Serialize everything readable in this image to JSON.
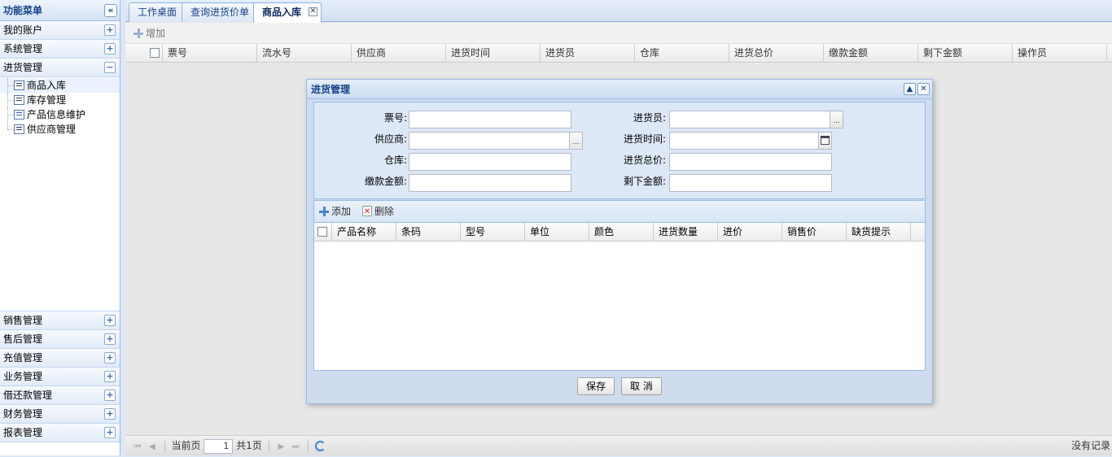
{
  "sidebar": {
    "title": "功能菜单",
    "collapse_icon": "«",
    "groups_top": [
      {
        "label": "我的账户",
        "toggle": "+"
      },
      {
        "label": "系统管理",
        "toggle": "+"
      },
      {
        "label": "进货管理",
        "toggle": "−"
      }
    ],
    "tree_items": [
      {
        "label": "商品入库",
        "selected": true
      },
      {
        "label": "库存管理",
        "selected": false
      },
      {
        "label": "产品信息维护",
        "selected": false
      },
      {
        "label": "供应商管理",
        "selected": false
      }
    ],
    "groups_bottom": [
      {
        "label": "销售管理",
        "toggle": "+"
      },
      {
        "label": "售后管理",
        "toggle": "+"
      },
      {
        "label": "充值管理",
        "toggle": "+"
      },
      {
        "label": "业务管理",
        "toggle": "+"
      },
      {
        "label": "借还款管理",
        "toggle": "+"
      },
      {
        "label": "财务管理",
        "toggle": "+"
      },
      {
        "label": "报表管理",
        "toggle": "+"
      }
    ]
  },
  "tabs": [
    {
      "label": "工作桌面"
    },
    {
      "label": "查询进货价单"
    },
    {
      "label": "商品入库",
      "active": true,
      "close": "✕"
    }
  ],
  "toolbar": {
    "add_label": "增加"
  },
  "main_grid": {
    "columns": [
      "票号",
      "流水号",
      "供应商",
      "进货时间",
      "进货员",
      "仓库",
      "进货总价",
      "缴款金额",
      "剩下金额",
      "操作员"
    ]
  },
  "pager": {
    "first": "⏮",
    "prev": "◀",
    "next": "▶",
    "last": "⏭",
    "current_label": "当前页",
    "page_value": "1",
    "total_label": "共1页",
    "info": "没有记录"
  },
  "dialog": {
    "title": "进货管理",
    "collapse_icon": "▲",
    "close_icon": "✕",
    "form": {
      "ticket_no_label": "票号:",
      "buyer_label": "进货员:",
      "supplier_label": "供应商:",
      "purchase_time_label": "进货时间:",
      "warehouse_label": "仓库:",
      "total_price_label": "进货总价:",
      "paid_amount_label": "缴款金额:",
      "remaining_label": "剩下金额:",
      "trigger_text": "..."
    },
    "detail_toolbar": {
      "add_label": "添加",
      "delete_label": "删除"
    },
    "detail_columns": [
      "产品名称",
      "条码",
      "型号",
      "单位",
      "颜色",
      "进货数量",
      "进价",
      "销售价",
      "缺货提示"
    ],
    "save_label": "保存",
    "cancel_label": "取 消"
  }
}
